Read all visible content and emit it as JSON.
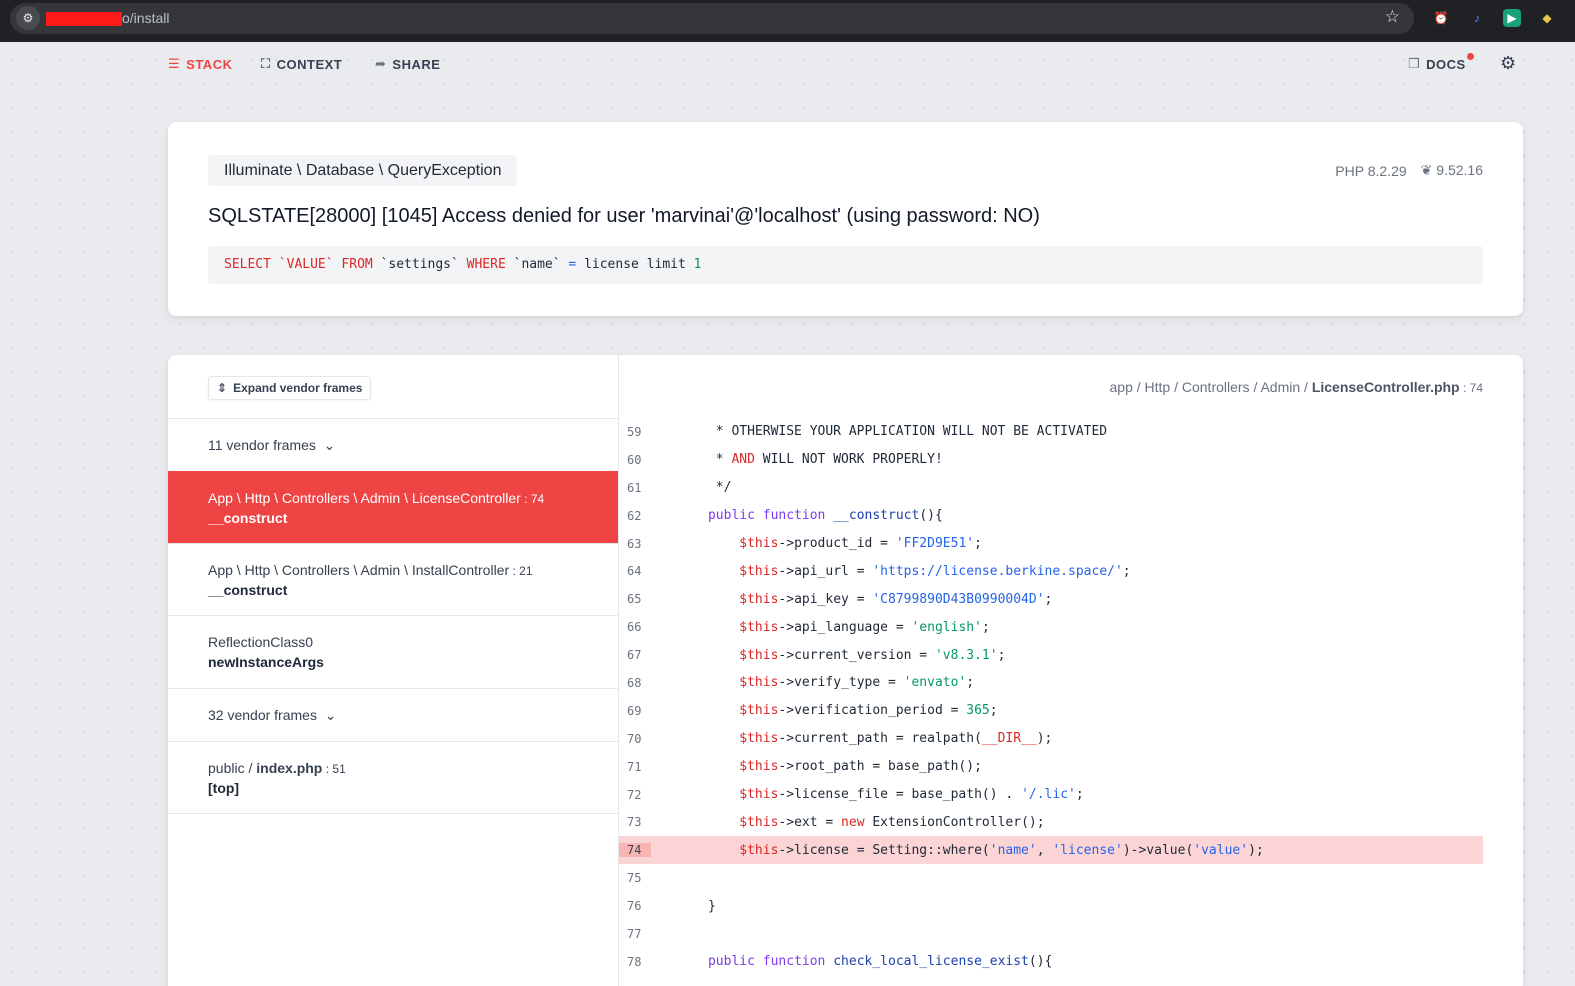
{
  "browser": {
    "url_suffix": "o/install"
  },
  "nav": {
    "stack": "STACK",
    "context": "CONTEXT",
    "share": "SHARE",
    "docs": "DOCS"
  },
  "exception": {
    "class": "Illuminate \\ Database \\ QueryException",
    "php_version": "PHP 8.2.29",
    "laravel_version": "9.52.16",
    "message": "SQLSTATE[28000] [1045] Access denied for user 'marvinai'@'localhost' (using password: NO)",
    "sql": {
      "select": "SELECT",
      "col": " `VALUE` ",
      "from": "FROM",
      "table": " `settings` ",
      "where": "WHERE",
      "name": " `name` ",
      "eq": "=",
      "rest": " license limit ",
      "limit": "1"
    }
  },
  "frames": {
    "expand_label": "Expand vendor frames",
    "vendor_group_1": "11 vendor frames",
    "vendor_group_2": "32 vendor frames",
    "items": [
      {
        "file": "App \\ Http \\ Controllers \\ Admin \\ LicenseController",
        "line": "74",
        "fn": "__construct"
      },
      {
        "file": "App \\ Http \\ Controllers \\ Admin \\ InstallController",
        "line": "21",
        "fn": "__construct"
      },
      {
        "file": "ReflectionClass0",
        "line": "",
        "fn": "newInstanceArgs"
      },
      {
        "file_prefix": "public / ",
        "file_name": "index.php",
        "line": "51",
        "fn": "[top]"
      }
    ]
  },
  "code": {
    "path_prefix": "app / Http / Controllers / Admin / ",
    "path_file": "LicenseController.php",
    "path_line": "74",
    "lines": {
      "59": "59",
      "60": "60",
      "61": "61",
      "62": "62",
      "63": "63",
      "64": "64",
      "65": "65",
      "66": "66",
      "67": "67",
      "68": "68",
      "69": "69",
      "70": "70",
      "71": "71",
      "72": "72",
      "73": "73",
      "74": "74",
      "75": "75",
      "76": "76",
      "77": "77",
      "78": "78"
    },
    "t": {
      "l59": "       * OTHERWISE YOUR APPLICATION WILL NOT BE ACTIVATED",
      "l60a": "       * ",
      "l60and": "AND",
      "l60b": " WILL NOT WORK PROPERLY!",
      "l61": "       */",
      "public": "public",
      "function": "function",
      "construct": "__construct",
      "paren": "(){",
      "this": "$this",
      "product_id": "->product_id = ",
      "product_val": "'FF2D9E51'",
      "api_url": "->api_url = ",
      "api_url_val": "'https://license.berkine.space/'",
      "api_key": "->api_key = ",
      "api_key_val": "'C8799890D43B0990004D'",
      "api_language": "->api_language = ",
      "api_language_val": "'english'",
      "current_version": "->current_version = ",
      "current_version_val": "'v8.3.1'",
      "verify_type": "->verify_type = ",
      "verify_type_val": "'envato'",
      "verification_period": "->verification_period = ",
      "verification_period_val": "365",
      "current_path": "->current_path = realpath(",
      "dir": "__DIR__",
      "close": ");",
      "semi": ";",
      "root_path": "->root_path = base_path();",
      "license_file": "->license_file = base_path() . ",
      "license_file_val": "'/.lic'",
      "ext": "->ext = ",
      "new": "new",
      "ext_rest": " ExtensionController();",
      "license": "->license = Setting::where(",
      "name_arg": "'name'",
      "comma": ", ",
      "license_arg": "'license'",
      "value_call": ")->value(",
      "value_arg": "'value'",
      "brace": "}",
      "check_fn": "check_local_license_exist",
      "check_paren": "(){"
    }
  }
}
